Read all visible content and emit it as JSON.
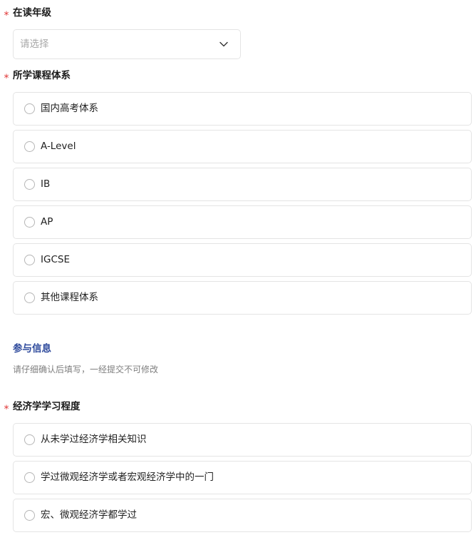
{
  "grade_field": {
    "label": "在读年级",
    "required_mark": "*",
    "placeholder": "请选择",
    "dropdown_icon": "chevron-down-icon"
  },
  "curriculum_field": {
    "label": "所学课程体系",
    "required_mark": "*",
    "options": [
      {
        "label": "国内高考体系",
        "selected": false
      },
      {
        "label": "A-Level",
        "selected": false
      },
      {
        "label": "IB",
        "selected": false
      },
      {
        "label": "AP",
        "selected": false
      },
      {
        "label": "IGCSE",
        "selected": false
      },
      {
        "label": "其他课程体系",
        "selected": false
      }
    ]
  },
  "participation_section": {
    "title": "参与信息",
    "description": "请仔细确认后填写，一经提交不可修改",
    "title_color": "#2e4a9c"
  },
  "economics_field": {
    "label": "经济学学习程度",
    "required_mark": "*",
    "options": [
      {
        "label": "从未学过经济学相关知识",
        "selected": false
      },
      {
        "label": "学过微观经济学或者宏观经济学中的一门",
        "selected": false
      },
      {
        "label": "宏、微观经济学都学过",
        "selected": false
      }
    ]
  },
  "colors": {
    "required": "#e03434",
    "border": "#e4e4e4",
    "placeholder": "#a8a8a8"
  }
}
